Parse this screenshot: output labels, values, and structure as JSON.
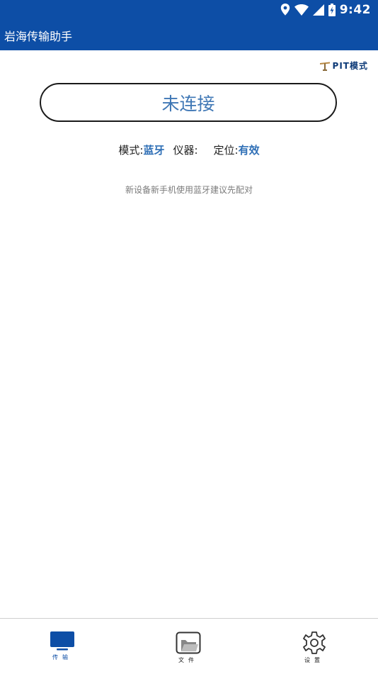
{
  "status": {
    "time": "9:42"
  },
  "app": {
    "title": "岩海传输助手"
  },
  "pit": {
    "label": "PIT模式"
  },
  "connection": {
    "label": "未连接"
  },
  "info": {
    "mode_label": "模式:",
    "mode_value": "蓝牙",
    "instrument_label": "仪器:",
    "instrument_value": "",
    "location_label": "定位:",
    "location_value": "有效"
  },
  "hint": "新设备新手机使用蓝牙建议先配对",
  "nav": {
    "items": [
      {
        "label": "传输",
        "icon": "monitor-icon",
        "active": true
      },
      {
        "label": "文件",
        "icon": "folder-icon",
        "active": false
      },
      {
        "label": "设置",
        "icon": "gear-icon",
        "active": false
      }
    ]
  },
  "colors": {
    "primary": "#0d4ea6",
    "accent_text": "#2f6fb6",
    "connect_text": "#3f77b5"
  }
}
